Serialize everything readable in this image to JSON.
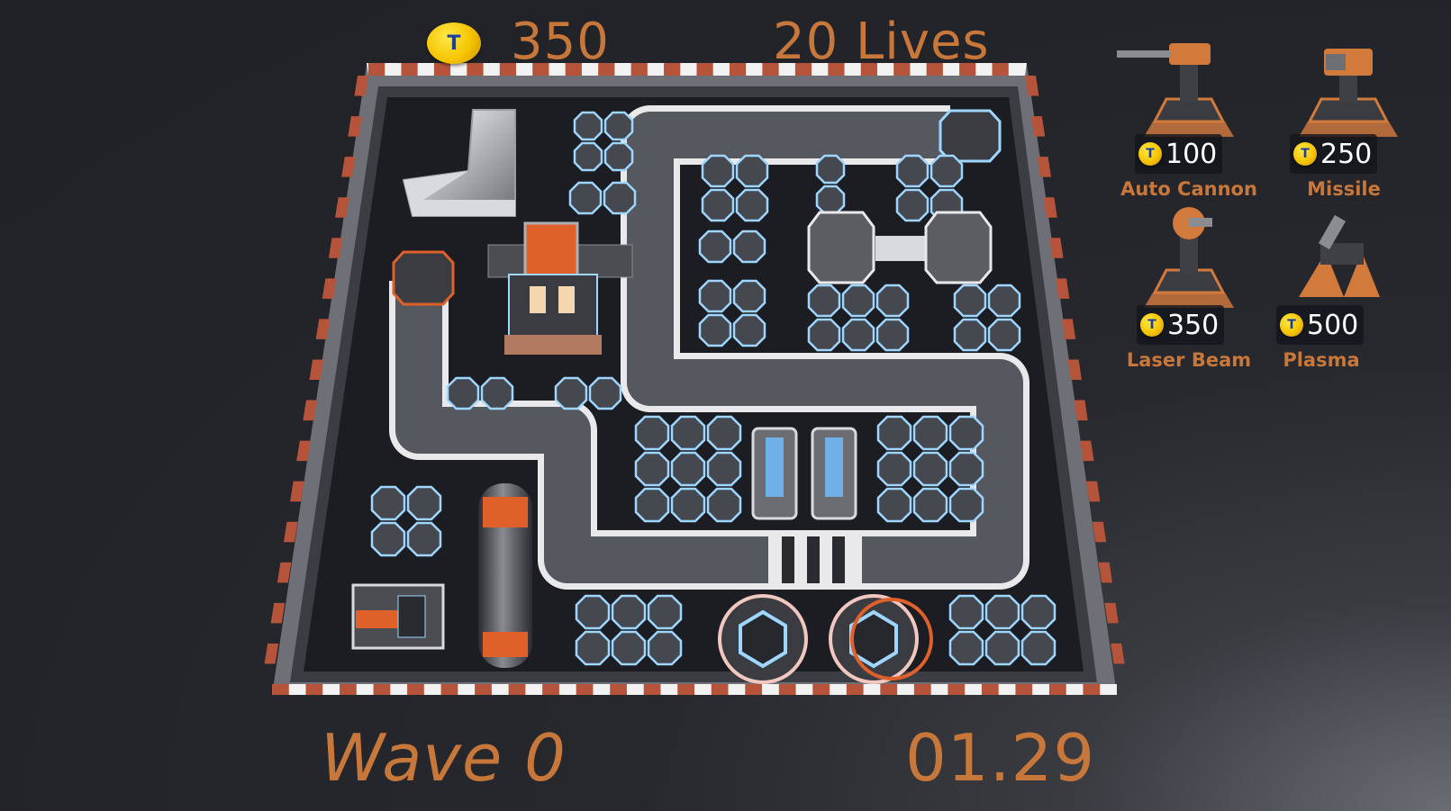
{
  "hud": {
    "coins": "350",
    "coin_symbol": "T",
    "lives": "20 Lives",
    "wave": "Wave 0",
    "timer": "01.29"
  },
  "towers": [
    {
      "name": "Auto Cannon",
      "price": "100",
      "icon": "auto-cannon-turret-icon"
    },
    {
      "name": "Missile",
      "price": "250",
      "icon": "missile-turret-icon"
    },
    {
      "name": "Laser Beam",
      "price": "350",
      "icon": "laser-beam-turret-icon"
    },
    {
      "name": "Plasma",
      "price": "500",
      "icon": "plasma-turret-icon"
    }
  ],
  "colors": {
    "hud_orange": "#c8773a",
    "coin_gold": "#f6c400",
    "board_floor": "#1b1d22",
    "path_grey": "#5a5d63",
    "pad_blue": "#9fd6ff",
    "accent_orange": "#e0602a"
  }
}
